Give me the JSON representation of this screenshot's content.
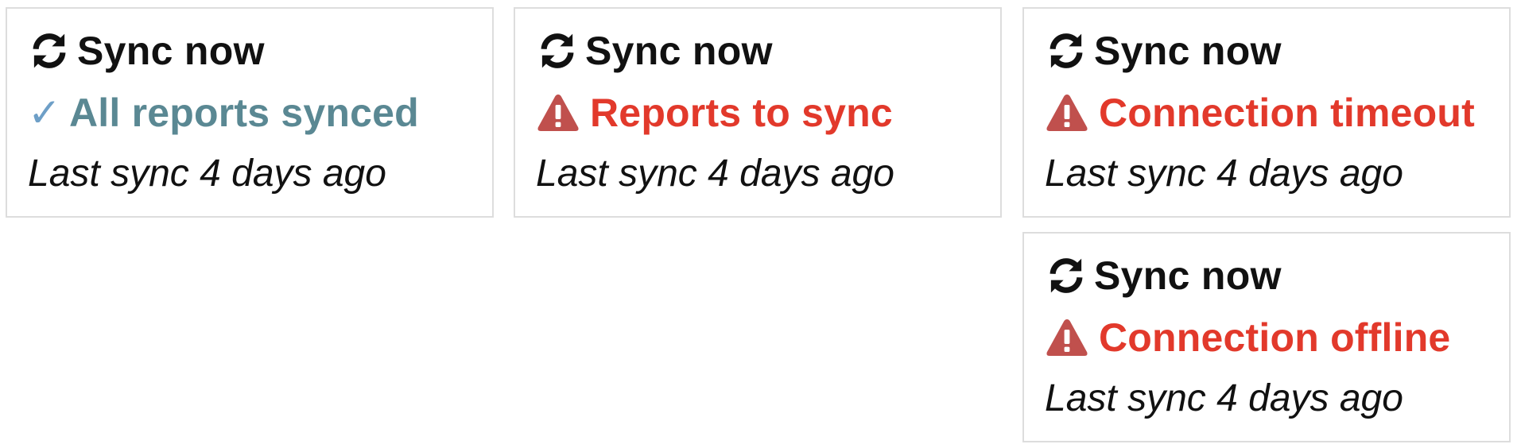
{
  "colors": {
    "ok_icon": "#6e9fc7",
    "ok_text": "#5a8893",
    "error_text": "#e2392b",
    "warning_icon": "#c0504d"
  },
  "cards": [
    {
      "sync_label": "Sync now",
      "sync_icon": "sync-icon",
      "status_type": "ok",
      "status_icon": "checkmark-icon",
      "status_text": "All reports synced",
      "last_sync": "Last sync 4 days ago"
    },
    {
      "sync_label": "Sync now",
      "sync_icon": "sync-icon",
      "status_type": "error",
      "status_icon": "warning-icon",
      "status_text": "Reports to sync",
      "last_sync": "Last sync 4 days ago"
    },
    {
      "sync_label": "Sync now",
      "sync_icon": "sync-icon",
      "status_type": "error",
      "status_icon": "warning-icon",
      "status_text": "Connection timeout",
      "last_sync": "Last sync 4 days ago"
    },
    {
      "sync_label": "Sync now",
      "sync_icon": "sync-icon",
      "status_type": "error",
      "status_icon": "warning-icon",
      "status_text": "Connection offline",
      "last_sync": "Last sync 4 days ago"
    }
  ]
}
